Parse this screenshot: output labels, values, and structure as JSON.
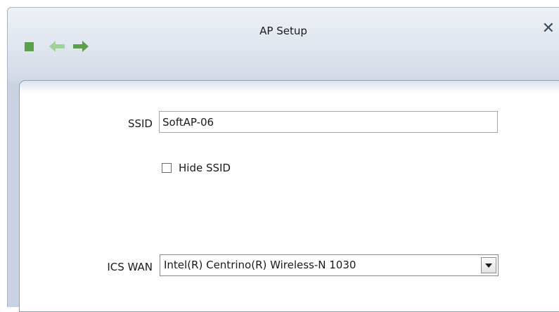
{
  "window": {
    "title": "AP Setup",
    "close_glyph": "✕"
  },
  "toolbar": {
    "icons": [
      "stop-icon",
      "back-arrow-icon",
      "forward-arrow-icon"
    ],
    "icon_color": "#5aa04a"
  },
  "form": {
    "ssid_label": "SSID",
    "ssid_value": "SoftAP-06",
    "hide_ssid_label": "Hide SSID",
    "hide_ssid_checked": false,
    "ics_wan_label": "ICS WAN",
    "ics_wan_value": "Intel(R) Centrino(R) Wireless-N 1030"
  }
}
